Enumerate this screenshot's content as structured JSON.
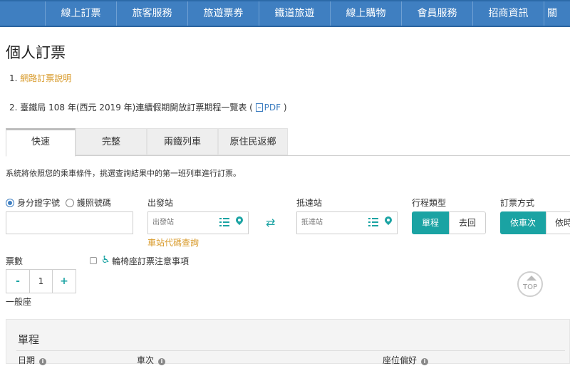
{
  "nav": {
    "items": [
      {
        "label": "線上訂票"
      },
      {
        "label": "旅客服務"
      },
      {
        "label": "旅遊票券"
      },
      {
        "label": "鐵道旅遊"
      },
      {
        "label": "線上購物"
      },
      {
        "label": "會員服務"
      },
      {
        "label": "招商資訊"
      },
      {
        "label": "關"
      }
    ]
  },
  "page": {
    "title": "個人訂票",
    "notice1_num": "1.",
    "notice1_link": "網路訂票說明",
    "notice2_num": "2.",
    "notice2_text": "臺鐵局 108 年(西元 2019 年)連續假期開放訂票期程一覽表 (",
    "notice2_pdf": "PDF",
    "notice2_close": ")"
  },
  "tabs": [
    {
      "label": "快速",
      "active": true
    },
    {
      "label": "完整"
    },
    {
      "label": "兩鐵列車"
    },
    {
      "label": "原住民返鄉"
    }
  ],
  "form": {
    "description": "系統將依照您的乘車條件，挑選查詢結果中的第一班列車進行訂票。",
    "id_type": {
      "option1": "身分證字號",
      "option2": "護照號碼",
      "selected": "身分證字號"
    },
    "departure": {
      "label": "出發站",
      "placeholder": "出發站"
    },
    "station_code_link": "車站代碼查詢",
    "arrival": {
      "label": "抵達站",
      "placeholder": "抵達站"
    },
    "trip_type": {
      "label": "行程類型",
      "option1": "單程",
      "option2": "去回",
      "selected": "單程"
    },
    "order_method": {
      "label": "訂票方式",
      "option1": "依車次",
      "option2": "依時",
      "selected": "依車次"
    },
    "tickets": {
      "label": "票數",
      "minus": "-",
      "value": "1",
      "plus": "+",
      "seat_type": "一般座"
    },
    "wheelchair_label": "輪椅座訂票注意事項"
  },
  "top_button": "TOP",
  "panel": {
    "title": "單程",
    "col_date": "日期",
    "col_train": "車次",
    "col_seat": "座位偏好"
  },
  "colors": {
    "nav_bg": "#3f7fc1",
    "accent_teal": "#1aa3a3",
    "link_orange": "#d89a2a"
  }
}
